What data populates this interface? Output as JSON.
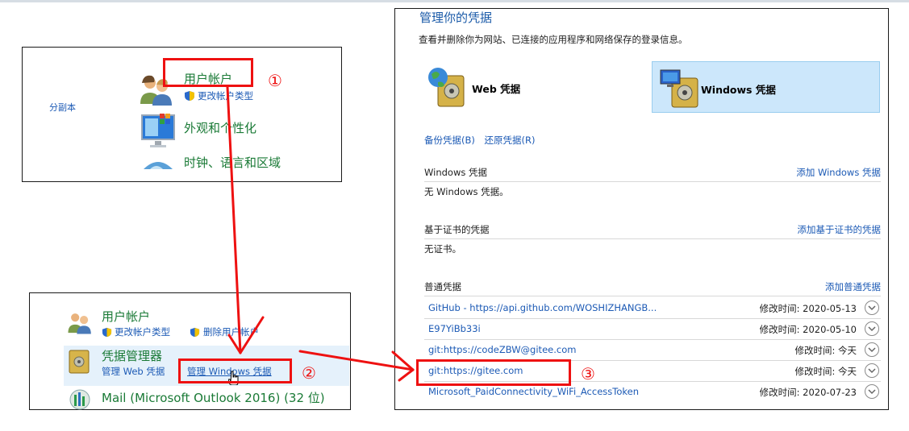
{
  "panel1": {
    "side_text": "分副本",
    "user_accounts": "用户帐户",
    "change_account_type": "更改帐户类型",
    "appearance": "外观和个性化",
    "clock_region": "时钟、语言和区域"
  },
  "panel2": {
    "user_accounts": "用户帐户",
    "change_account_type": "更改帐户类型",
    "delete_account": "删除用户帐户",
    "credential_manager": "凭据管理器",
    "manage_web": "管理 Web 凭据",
    "manage_windows": "管理 Windows 凭据",
    "mail": "Mail (Microsoft Outlook 2016) (32 位)"
  },
  "panel3": {
    "title": "管理你的凭据",
    "description": "查看并删除你为网站、已连接的应用程序和网络保存的登录信息。",
    "web_tile": "Web 凭据",
    "windows_tile": "Windows 凭据",
    "backup": "备份凭据(B)",
    "restore": "还原凭据(R)",
    "win_section": {
      "header": "Windows 凭据",
      "add": "添加 Windows 凭据",
      "empty": "无 Windows 凭据。"
    },
    "cert_section": {
      "header": "基于证书的凭据",
      "add": "添加基于证书的凭据",
      "empty": "无证书。"
    },
    "generic_section": {
      "header": "普通凭据",
      "add": "添加普通凭据"
    },
    "credentials": [
      {
        "name": "GitHub - https://api.github.com/WOSHIZHANGB...",
        "modified": "修改时间:  2020-05-13"
      },
      {
        "name": "E97YiBb33i",
        "modified": "修改时间:  2020-05-10"
      },
      {
        "name": "git:https://codeZBW@gitee.com",
        "modified": "修改时间:  今天"
      },
      {
        "name": "git:https://gitee.com",
        "modified": "修改时间:  今天"
      },
      {
        "name": "Microsoft_PaidConnectivity_WiFi_AccessToken",
        "modified": "修改时间:  2020-07-23"
      }
    ]
  },
  "annotations": {
    "step1": "①",
    "step2": "②",
    "step3": "③"
  },
  "colors": {
    "link": "#1c5ab5",
    "green": "#1a7a36",
    "annotation": "#ee1111",
    "selected_tile": "#cce7fb"
  }
}
